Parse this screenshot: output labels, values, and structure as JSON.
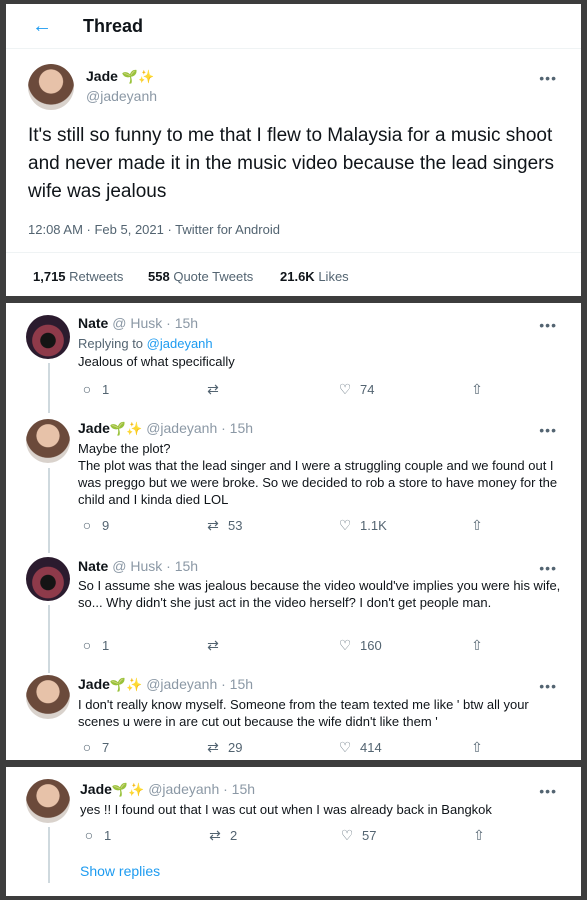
{
  "header": {
    "back_icon": "←",
    "title": "Thread"
  },
  "main_tweet": {
    "name": "Jade",
    "emoji": "✨",
    "sprout": "🌱",
    "handle": "@jadeyanh",
    "text": "It's still so funny to me that I flew to Malaysia for a music shoot and never made it in the music video because the lead singers wife was jealous",
    "meta": "12:08 AM · Feb 5, 2021 · Twitter for Android",
    "stats": {
      "retweets": "1,715",
      "retweets_label": "Retweets",
      "quotes": "558",
      "quotes_label": "Quote Tweets",
      "likes": "21.6K",
      "likes_label": "Likes"
    }
  },
  "replies": [
    {
      "name": "Nate",
      "handle": "@ Husk",
      "time": "· 15h",
      "replying_label": "Replying to",
      "replying_handle": "@jadeyanh",
      "text": "Jealous of what specifically",
      "counts": {
        "reply": "1",
        "retweet": "",
        "like": "74"
      }
    },
    {
      "name": "Jade",
      "emoji": "✨",
      "sprout": "🌱",
      "handle": "@jadeyanh",
      "time": "· 15h",
      "text": "Maybe the plot?\nThe plot was that the lead singer and I were a struggling couple and we found out I was preggo but we were broke. So we decided to rob a store to have money for the child and I kinda died LOL",
      "counts": {
        "reply": "9",
        "retweet": "53",
        "like": "1.1K"
      }
    },
    {
      "name": "Nate",
      "handle": "@ Husk",
      "time": "· 15h",
      "text": "So I assume she was jealous because the video would've implies you were his wife, so... Why didn't she just act in the video herself? I don't get people man.",
      "counts": {
        "reply": "1",
        "retweet": "",
        "like": "160"
      }
    },
    {
      "name": "Jade",
      "emoji": "✨",
      "sprout": "🌱",
      "handle": "@jadeyanh",
      "time": "· 15h",
      "text": "I don't really know myself. Someone from the team texted me like ' btw all your scenes u were in are cut out because the wife didn't like them '",
      "counts": {
        "reply": "7",
        "retweet": "29",
        "like": "414"
      }
    },
    {
      "name": "Jade",
      "emoji": "✨",
      "sprout": "🌱",
      "handle": "@jadeyanh",
      "time": "· 15h",
      "text": "yes !! I found out that I was cut out when I was already back in Bangkok",
      "counts": {
        "reply": "1",
        "retweet": "2",
        "like": "57"
      }
    }
  ],
  "show_replies": "Show replies",
  "icons": {
    "more": "•••",
    "reply": "○",
    "retweet": "⇄",
    "like": "♡",
    "share": "⇧"
  }
}
